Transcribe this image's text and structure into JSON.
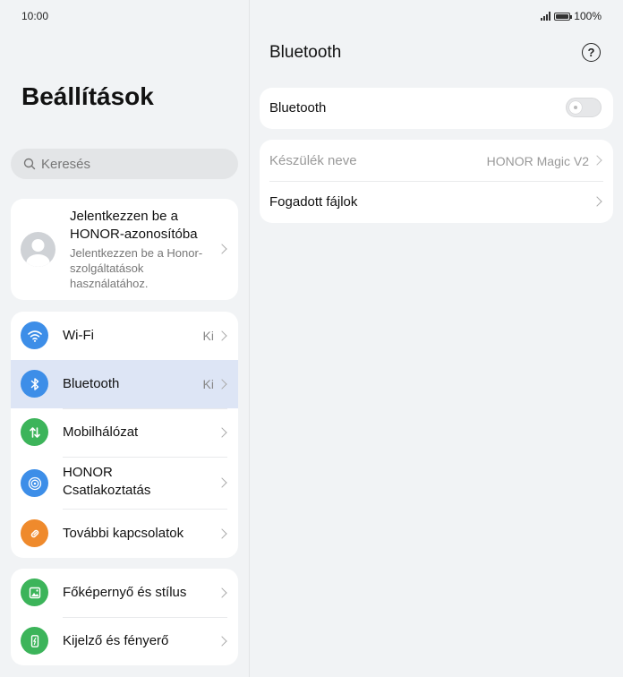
{
  "status_bar": {
    "time": "10:00",
    "battery": "100%"
  },
  "settings": {
    "title": "Beállítások",
    "search_placeholder": "Keresés",
    "account": {
      "title": "Jelentkezzen be a HONOR-azonosítóba",
      "subtitle": "Jelentkezzen be a Honor-szolgáltatások használatához."
    },
    "group1": [
      {
        "label": "Wi-Fi",
        "value": "Ki",
        "icon": "wifi-icon",
        "color": "#3d8ee8"
      },
      {
        "label": "Bluetooth",
        "value": "Ki",
        "icon": "bluetooth-icon",
        "color": "#3d8ee8"
      },
      {
        "label": "Mobilhálózat",
        "value": "",
        "icon": "mobile-data-icon",
        "color": "#3cb45a"
      },
      {
        "label": "HONOR Csatlakoztatás",
        "value": "",
        "icon": "honor-connect-icon",
        "color": "#3d8ee8"
      },
      {
        "label": "További kapcsolatok",
        "value": "",
        "icon": "link-icon",
        "color": "#ef8a2c"
      }
    ],
    "group2": [
      {
        "label": "Főképernyő és stílus",
        "icon": "home-screen-icon",
        "color": "#3cb45a"
      },
      {
        "label": "Kijelző és fényerő",
        "icon": "display-icon",
        "color": "#3cb45a"
      }
    ]
  },
  "bluetooth_panel": {
    "title": "Bluetooth",
    "toggle_label": "Bluetooth",
    "toggle_state": "off",
    "device_name_label": "Készülék neve",
    "device_name_value": "HONOR Magic V2",
    "received_files_label": "Fogadott fájlok"
  },
  "colors": {
    "accent": "#3d8ee8",
    "highlight": "#dde5f5"
  }
}
